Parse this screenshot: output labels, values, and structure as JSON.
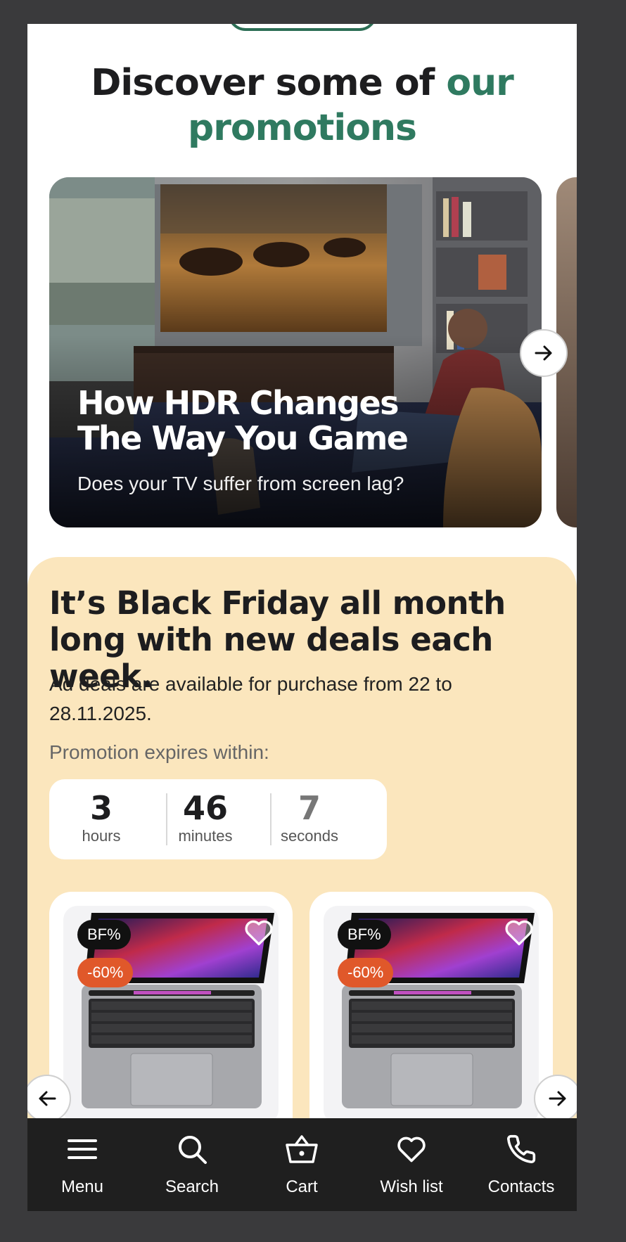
{
  "promotions": {
    "title_plain": "Discover some of ",
    "title_accent": "our promotions",
    "card": {
      "title": "How HDR Changes The Way You Game",
      "subtitle": "Does your TV suffer from screen lag?"
    }
  },
  "black_friday": {
    "title": "It’s Black Friday all month long with new deals each week.",
    "description": "Ad deals are available for purchase from 22 to 28.11.2025.",
    "expires_label": "Promotion expires within:",
    "countdown": [
      {
        "value": "3",
        "unit": "hours"
      },
      {
        "value": "46",
        "unit": "minutes"
      },
      {
        "value": "7",
        "unit": "seconds"
      }
    ],
    "products": [
      {
        "badge": "BF%",
        "discount": "-60%"
      },
      {
        "badge": "BF%",
        "discount": "-60%"
      }
    ]
  },
  "tabbar": {
    "items": [
      {
        "label": "Menu",
        "icon": "menu-icon"
      },
      {
        "label": "Search",
        "icon": "search-icon"
      },
      {
        "label": "Cart",
        "icon": "basket-icon"
      },
      {
        "label": "Wish list",
        "icon": "heart-icon"
      },
      {
        "label": "Contacts",
        "icon": "phone-icon"
      }
    ]
  },
  "colors": {
    "accent": "#2f7a60",
    "bf_background": "#fbe6bd",
    "discount_badge": "#e0582a",
    "tabbar": "#1f1f1f"
  }
}
